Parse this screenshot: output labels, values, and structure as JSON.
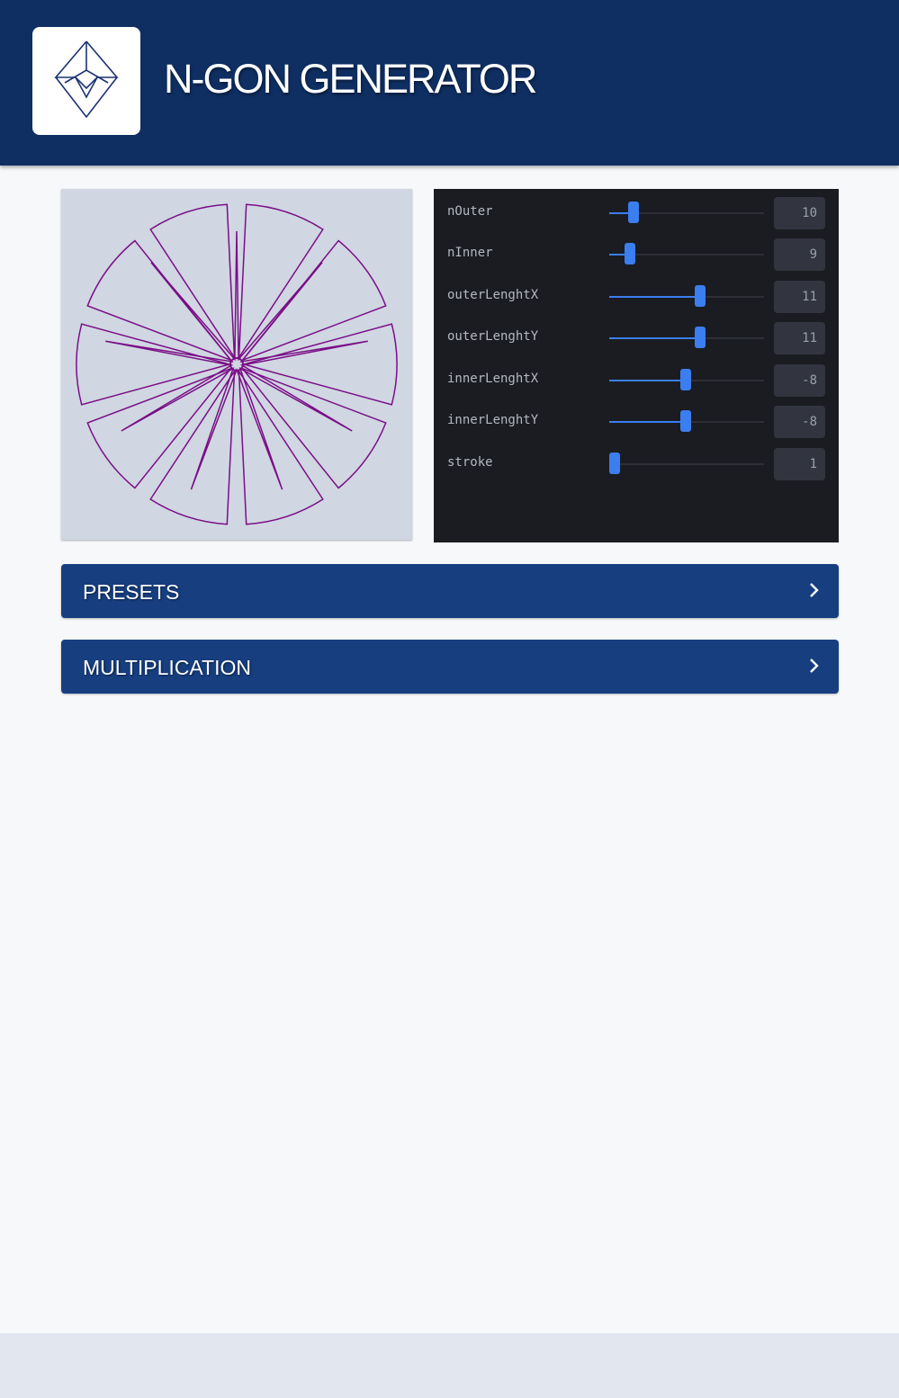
{
  "app": {
    "title": "N-GON GENERATOR"
  },
  "colors": {
    "header_bg": "#0f2f63",
    "accent": "#3b7ef0",
    "shape_stroke": "#7a0e86",
    "preview_bg": "#d0d6e2",
    "panel_bg": "#1a1c21",
    "accordion_bg": "#173f80"
  },
  "controls": [
    {
      "label": "nOuter",
      "value": "10",
      "level": 0.12
    },
    {
      "label": "nInner",
      "value": "9",
      "level": 0.1
    },
    {
      "label": "outerLenghtX",
      "value": "11",
      "level": 0.55
    },
    {
      "label": "outerLenghtY",
      "value": "11",
      "level": 0.55
    },
    {
      "label": "innerLenghtX",
      "value": "-8",
      "level": 0.46
    },
    {
      "label": "innerLenghtY",
      "value": "-8",
      "level": 0.46
    },
    {
      "label": "stroke",
      "value": "1",
      "level": 0.0
    }
  ],
  "sections": [
    {
      "label": "PRESETS",
      "icon": "chevron-right-icon"
    },
    {
      "label": "MULTIPLICATION",
      "icon": "chevron-right-icon"
    }
  ]
}
